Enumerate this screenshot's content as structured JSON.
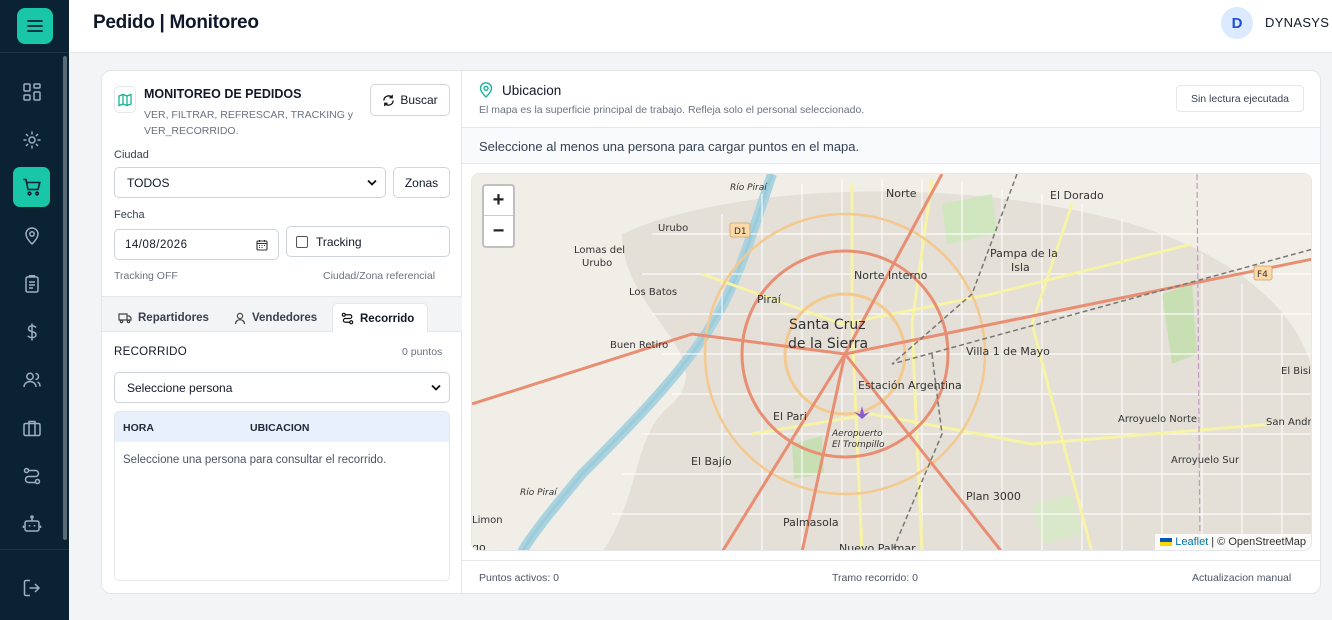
{
  "app": {
    "title": "Pedido | Monitoreo"
  },
  "user": {
    "initial": "D",
    "name": "DYNASYS"
  },
  "sidebar": {
    "items": [
      {
        "icon": "dashboard-icon"
      },
      {
        "icon": "gear-icon"
      },
      {
        "icon": "cart-icon",
        "active": true
      },
      {
        "icon": "map-pin-icon"
      },
      {
        "icon": "clipboard-icon"
      },
      {
        "icon": "dollar-icon"
      },
      {
        "icon": "users-icon"
      },
      {
        "icon": "briefcase-icon"
      },
      {
        "icon": "route-icon"
      },
      {
        "icon": "robot-icon"
      }
    ],
    "logout_icon": "logout-icon"
  },
  "panel": {
    "title": "MONITOREO DE PEDIDOS",
    "subtitle": "VER, FILTRAR, REFRESCAR, TRACKING y VER_RECORRIDO.",
    "search_label": "Buscar",
    "city_label": "Ciudad",
    "city_value": "TODOS",
    "zones_label": "Zonas",
    "date_label": "Fecha",
    "date_value": "14/08/2026",
    "tracking_label": "Tracking",
    "tracking_status": "Tracking OFF",
    "reference": "Ciudad/Zona referencial"
  },
  "tabs": [
    {
      "label": "Repartidores",
      "icon": "truck-icon"
    },
    {
      "label": "Vendedores",
      "icon": "person-icon"
    },
    {
      "label": "Recorrido",
      "icon": "route-icon",
      "active": true
    }
  ],
  "route": {
    "title": "RECORRIDO",
    "count": "0 puntos",
    "person_select": "Seleccione persona",
    "columns": [
      "HORA",
      "UBICACION"
    ],
    "empty": "Seleccione una persona para consultar el recorrido."
  },
  "location": {
    "title": "Ubicacion",
    "subtitle": "El mapa es la superficie principal de trabajo. Refleja solo el personal seleccionado.",
    "status": "Sin lectura ejecutada",
    "hint": "Seleccione al menos una persona para cargar puntos en el mapa."
  },
  "map": {
    "zoom_in": "+",
    "zoom_out": "−",
    "attribution_link": "Leaflet",
    "attribution_text": "| © OpenStreetMap",
    "labels": {
      "norte": "Norte",
      "el_dorado": "El Dorado",
      "rio_pirai_top": "Río Piraí",
      "urubo": "Urubo",
      "d1": "D1",
      "lomas_del": "Lomas del",
      "urubo2": "Urubo",
      "pampa_de_la": "Pampa de la",
      "isla": "Isla",
      "norte_interno": "Norte Interno",
      "f4": "F4",
      "los_batos": "Los Batos",
      "pirai": "Piraí",
      "santa_cruz": "Santa Cruz",
      "de_la_sierra": "de la Sierra",
      "buen_retiro": "Buen Retiro",
      "villa_1_de_mayo": "Villa 1 de Mayo",
      "el_bisito": "El Bisit",
      "estacion_argentina": "Estación Argentina",
      "el_pari": "El Pari",
      "aeropuerto": "Aeropuerto",
      "el_trompillo": "El Trompillo",
      "arroyuelo_norte": "Arroyuelo Norte",
      "san_andres": "San Andre",
      "el_bajio": "El Bajío",
      "arroyuelo_sur": "Arroyuelo Sur",
      "rio_pirai_bottom": "Río Piraí",
      "plan_3000": "Plan 3000",
      "limon": "Limon",
      "palmasola": "Palmasola",
      "nuevo_palmar": "Nuevo Palmar",
      "edge": "go"
    }
  },
  "footer": {
    "active_points": "Puntos activos: 0",
    "route_segment": "Tramo recorrido: 0",
    "update_mode": "Actualizacion manual"
  }
}
